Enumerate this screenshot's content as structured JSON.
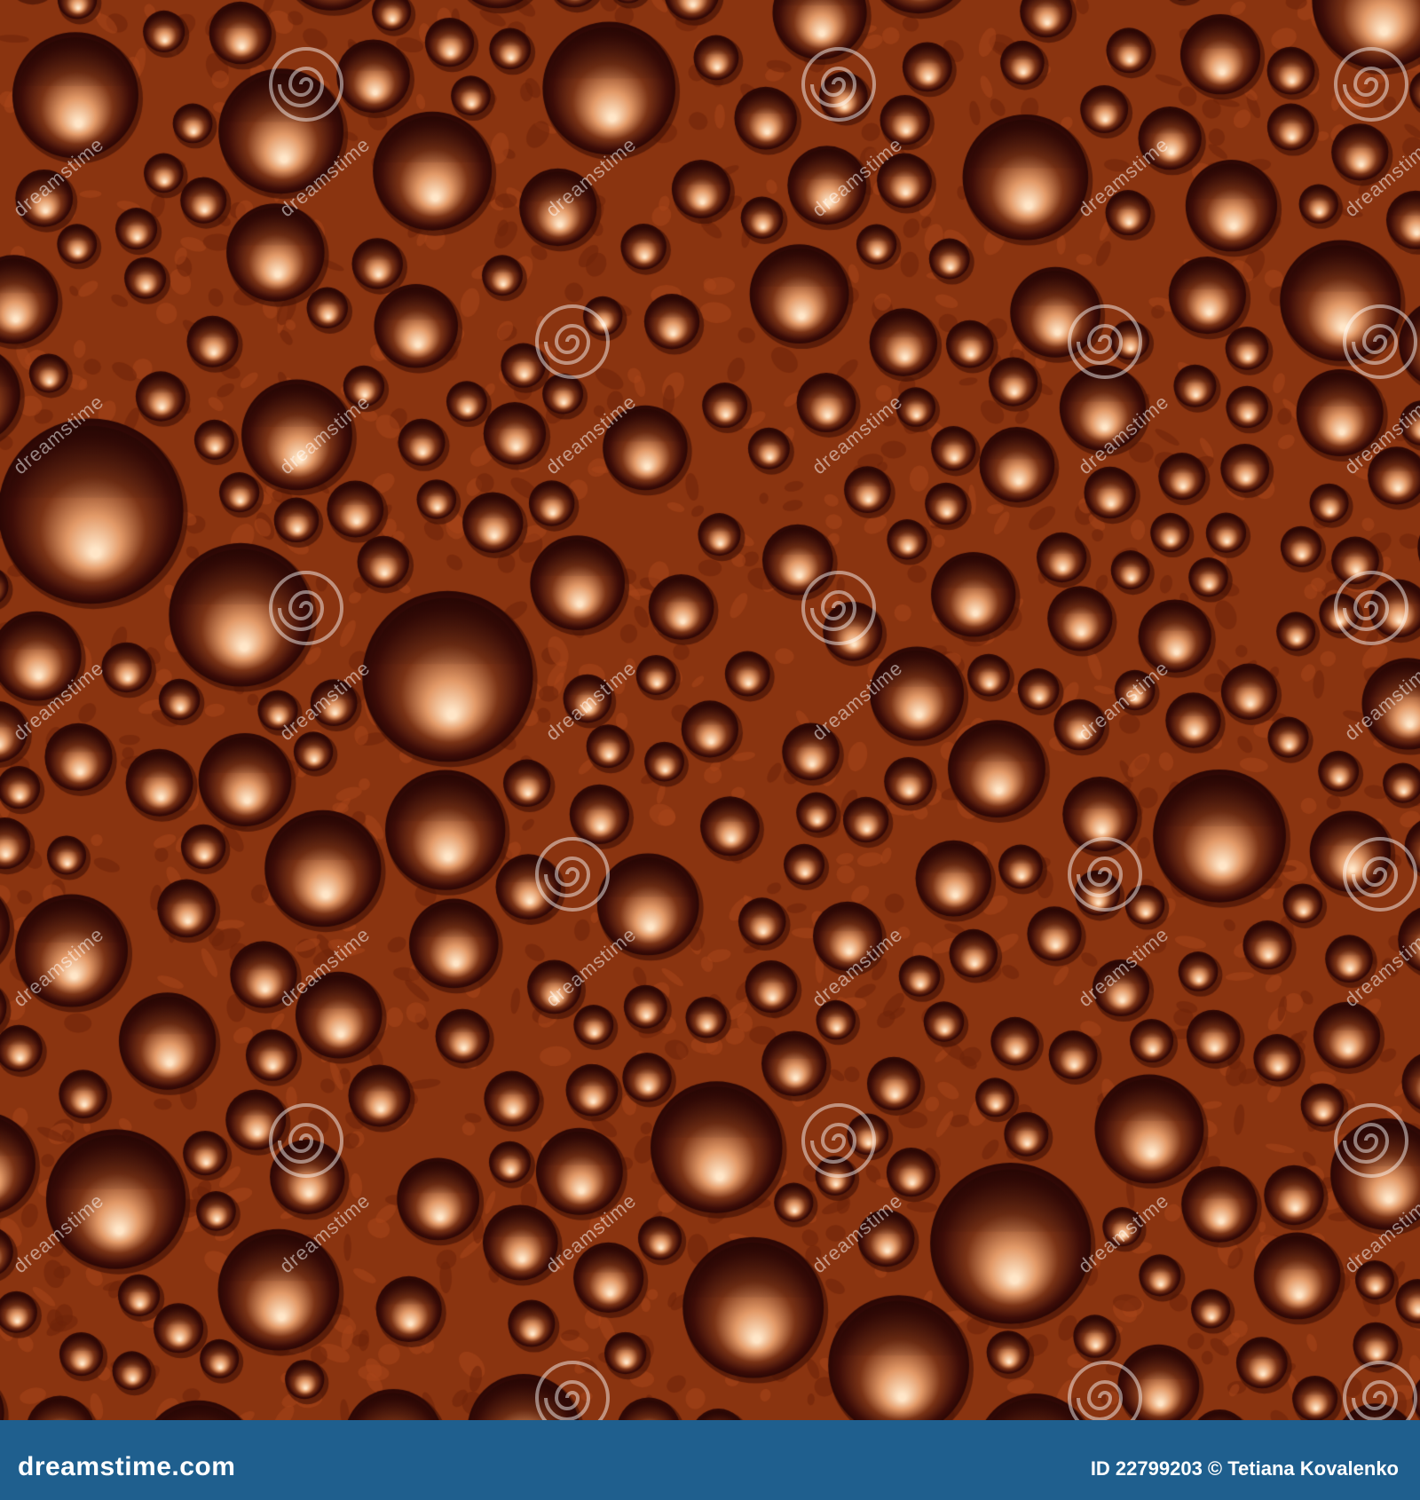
{
  "image": {
    "subject": "chocolate-bubbles-texture",
    "colors": {
      "background": "#8a3410",
      "bubble_dark": "#2a0705",
      "bubble_mid": "#7a3316",
      "bubble_light": "#ffe6c8",
      "footer": "#1f5f8e"
    }
  },
  "watermark": {
    "text": "dreamstime",
    "icon": "spiral-logo-icon"
  },
  "footer": {
    "site_name": "dreamstime.com",
    "credit": "ID 22799203 © Tetiana Kovalenko"
  }
}
